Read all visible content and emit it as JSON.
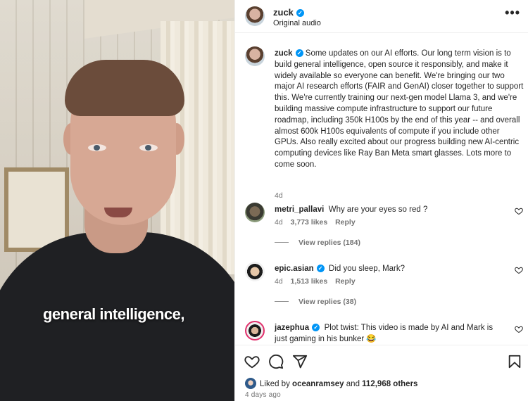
{
  "video": {
    "caption": "general intelligence,"
  },
  "header": {
    "username": "zuck",
    "subtitle": "Original audio",
    "more_label": "•••"
  },
  "post": {
    "username": "zuck",
    "text": "Some updates on our AI efforts. Our long term vision is to build general intelligence, open source it responsibly, and make it widely available so everyone can benefit. We're bringing our two major AI research efforts (FAIR and GenAI) closer together to support this. We're currently training our next-gen model Llama 3, and we're building massive compute infrastructure to support our future roadmap, including 350k H100s by the end of this year -- and overall almost 600k H100s equivalents of compute if you include other GPUs. Also really excited about our progress building new AI-centric computing devices like Ray Ban Meta smart glasses. Lots more to come soon.",
    "age": "4d"
  },
  "comments": [
    {
      "username": "metri_pallavi",
      "verified": false,
      "text": "Why are your eyes so red ?",
      "age": "4d",
      "likes": "3,773 likes",
      "reply": "Reply",
      "view_replies": "View replies (184)"
    },
    {
      "username": "epic.asian",
      "verified": true,
      "text": "Did you sleep, Mark?",
      "age": "4d",
      "likes": "1,513 likes",
      "reply": "Reply",
      "view_replies": "View replies (38)"
    },
    {
      "username": "jazephua",
      "verified": true,
      "text": "Plot twist: This video is made by AI and Mark is just gaming in his bunker 😂"
    }
  ],
  "footer": {
    "liked_by_prefix": "Liked by",
    "liked_by_user": "oceanramsey",
    "liked_by_and": "and",
    "liked_by_others": "112,968 others",
    "time_ago": "4 days ago"
  },
  "icons": [
    "heart-icon",
    "comment-icon",
    "share-icon",
    "bookmark-icon",
    "verified-badge-icon",
    "more-options-icon"
  ],
  "colors": {
    "verified": "#0095f6",
    "muted_text": "#737373",
    "text": "#262626"
  }
}
